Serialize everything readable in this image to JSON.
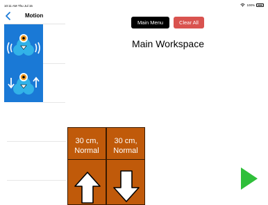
{
  "status_bar": {
    "time": "10:11 AM  Thu Jul 15",
    "battery": "100%"
  },
  "side_panel": {
    "title": "Motion",
    "blocks": [
      {
        "icon": "robot-wiggle-icon"
      },
      {
        "icon": "robot-move-icon"
      }
    ]
  },
  "toolbar": {
    "main_menu_label": "Main Menu",
    "clear_all_label": "Clear All"
  },
  "workspace": {
    "title": "Main Workspace",
    "program_blocks": [
      {
        "label_line1": "30 cm,",
        "label_line2": "Normal",
        "direction": "forward",
        "icon": "arrow-up-icon"
      },
      {
        "label_line1": "30 cm,",
        "label_line2": "Normal",
        "direction": "backward",
        "icon": "arrow-down-icon"
      }
    ]
  },
  "colors": {
    "palette_bg": "#1a79d6",
    "block_bg": "#c05a0a",
    "clear_all": "#d9534f",
    "main_menu": "#000000",
    "play": "#2fbf3a",
    "back_chevron": "#1a79d6"
  }
}
